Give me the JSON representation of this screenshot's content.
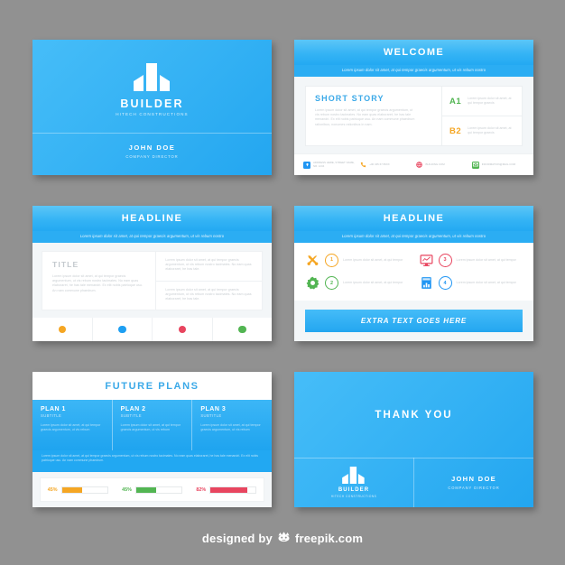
{
  "theme": {
    "background": "#919191",
    "brand_blue": "#2badf3",
    "accent_orange": "#f5a623",
    "accent_green": "#52b552",
    "accent_red": "#e8455f",
    "accent_blue": "#2196f3",
    "card_white": "#ffffff"
  },
  "lorem": {
    "strip": "Lorem ipsum dolor sit amet, at qui tempor graecis argumentum, ut vis rebum nostro",
    "short_story_body": "Lorem ipsum dolor sit amet, at qui tempor graecis argumentum, ut vis rebum nostro tacimates. No eam quas elaboraret, he has tale menandri. Ex elit nobis patrioque usu. An nam commune phaedrum rationibus, nonumes rationibus in nam.",
    "kv_body": "Lorem ipsum dolor sit amet, at qui tempor graecis",
    "block_a": "Lorem ipsum dolor sit amet, at qui tempor graecis argumentum, ut vis rebum nostro tacimates. No eam quas elaboraret, he has tale menandri. Ex elit nobis patrioque usu. An nam commune phaedrum.",
    "block_b": "Lorem ipsum dolor sit amet, at qui tempor graecis argumentum, ut vis rebum nostro tacimates. No eam quas elaboraret, he has tale.",
    "feature_body": "Lorem ipsum dolor sit amet, at qui tempor",
    "plan_body": "Lorem ipsum dolor sit amet, at qui tempor graecis argumentum, ut vis rebum",
    "band_body": "Lorem ipsum dolor sit amet, at qui tempor graecis argumentum, ut vis rebum nostro tacimates. No eam quas elaboraret, he has tale menandri. Ex elit nobis patrioque usu. An nam commune phaedrum."
  },
  "slide1": {
    "logo_icon": "building-logo-icon",
    "brand": "BUILDER",
    "brand_sub": "HITECH CONSTRUCTIONS",
    "person_name": "JOHN DOE",
    "person_role": "COMPANY DIRECTOR"
  },
  "slide2": {
    "title": "WELCOME",
    "panel_title": "SHORT STORY",
    "items": [
      {
        "key": "A1",
        "color": "#52b552"
      },
      {
        "key": "B2",
        "color": "#f5a623"
      }
    ],
    "contacts": [
      {
        "icon": "location-pin-icon",
        "color": "#2196f3",
        "text": "ADDRESS HERE, STREET NAME, NR. 1234"
      },
      {
        "icon": "phone-icon",
        "color": "#f5a623",
        "text": "+00 345 67 89XX"
      },
      {
        "icon": "globe-icon",
        "color": "#e8455f",
        "text": "BUILDING.COM"
      },
      {
        "icon": "envelope-icon",
        "color": "#52b552",
        "text": "INFORMATION@MAIL.COM"
      }
    ]
  },
  "slide3": {
    "title": "HEADLINE",
    "panel_title": "TITLE",
    "dots": [
      {
        "name": "dot-orange",
        "color": "#f5a623"
      },
      {
        "name": "dot-blue",
        "color": "#1e9ff2"
      },
      {
        "name": "dot-red",
        "color": "#e8455f"
      },
      {
        "name": "dot-green",
        "color": "#52b552"
      }
    ]
  },
  "slide4": {
    "title": "HEADLINE",
    "features": [
      {
        "icon": "tools-icon",
        "color": "#f5a623",
        "number": "1"
      },
      {
        "icon": "monitor-chart-icon",
        "color": "#e8455f",
        "number": "3"
      },
      {
        "icon": "gear-icon",
        "color": "#52b552",
        "number": "2"
      },
      {
        "icon": "report-chart-icon",
        "color": "#2196f3",
        "number": "4"
      }
    ],
    "cta_label": "EXTRA TEXT GOES HERE"
  },
  "slide5": {
    "title": "FUTURE PLANS",
    "plans": [
      {
        "title": "PLAN 1",
        "subtitle": "SUBTITLE"
      },
      {
        "title": "PLAN 2",
        "subtitle": "SUBTITLE"
      },
      {
        "title": "PLAN 3",
        "subtitle": "SUBTITLE"
      }
    ],
    "progress": [
      {
        "label": "45%",
        "value": 45,
        "color": "#f5a623"
      },
      {
        "label": "45%",
        "value": 45,
        "color": "#52b552"
      },
      {
        "label": "82%",
        "value": 82,
        "color": "#e8455f"
      }
    ]
  },
  "slide6": {
    "title": "THANK YOU",
    "logo_icon": "building-logo-icon",
    "brand": "BUILDER",
    "brand_sub": "HITECH CONSTRUCTIONS",
    "person_name": "JOHN DOE",
    "person_role": "COMPANY DIRECTOR"
  },
  "credit": {
    "prefix": "designed by",
    "logo_icon": "freepik-crown-icon",
    "name": "freepik.com"
  }
}
